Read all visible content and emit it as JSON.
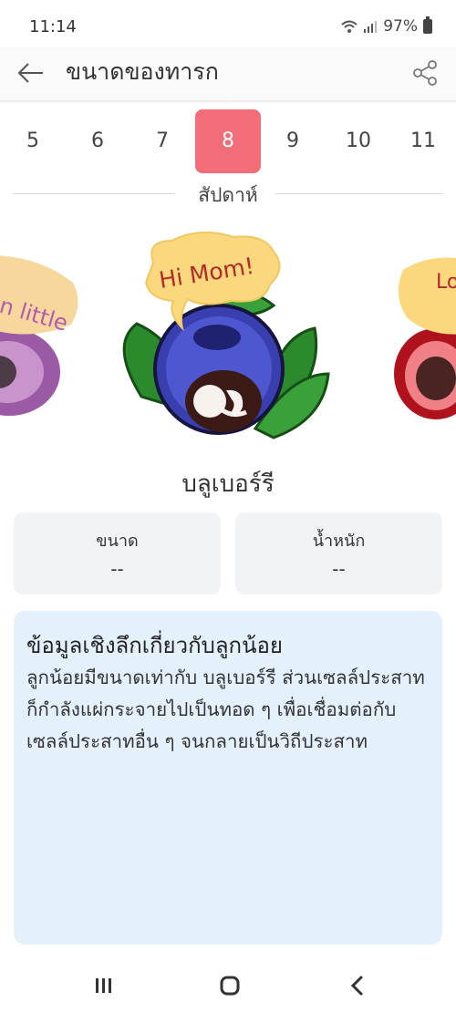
{
  "status_bar": {
    "time": "11:14",
    "battery": "97%"
  },
  "app_bar": {
    "title": "ขนาดของทารก"
  },
  "weeks": {
    "items": [
      "5",
      "6",
      "7",
      "8",
      "9",
      "10",
      "11"
    ],
    "selected": "8",
    "unit_label": "สัปดาห์"
  },
  "carousel": {
    "current": {
      "bubble_text": "Hi Mom!"
    },
    "previous": {
      "bubble_text": "n little"
    },
    "next": {
      "bubble_text": "Lo at"
    }
  },
  "fruit": {
    "name": "บลูเบอร์รี"
  },
  "stats": {
    "size": {
      "label": "ขนาด",
      "value": "--"
    },
    "weight": {
      "label": "น้ำหนัก",
      "value": "--"
    }
  },
  "insight": {
    "title": "ข้อมูลเชิงลึกเกี่ยวกับลูกน้อย",
    "body": "ลูกน้อยมีขนาดเท่ากับ บลูเบอร์รี ส่วนเซลล์ประสาทก็กำลังแผ่กระจายไปเป็นทอด ๆ เพื่อเชื่อมต่อกับเซลล์ประสาทอื่น ๆ จนกลายเป็นวิถีประสาท"
  },
  "colors": {
    "accent": "#f26d78",
    "card_bg": "#f2f3f5",
    "info_bg": "#e4f1fd"
  }
}
